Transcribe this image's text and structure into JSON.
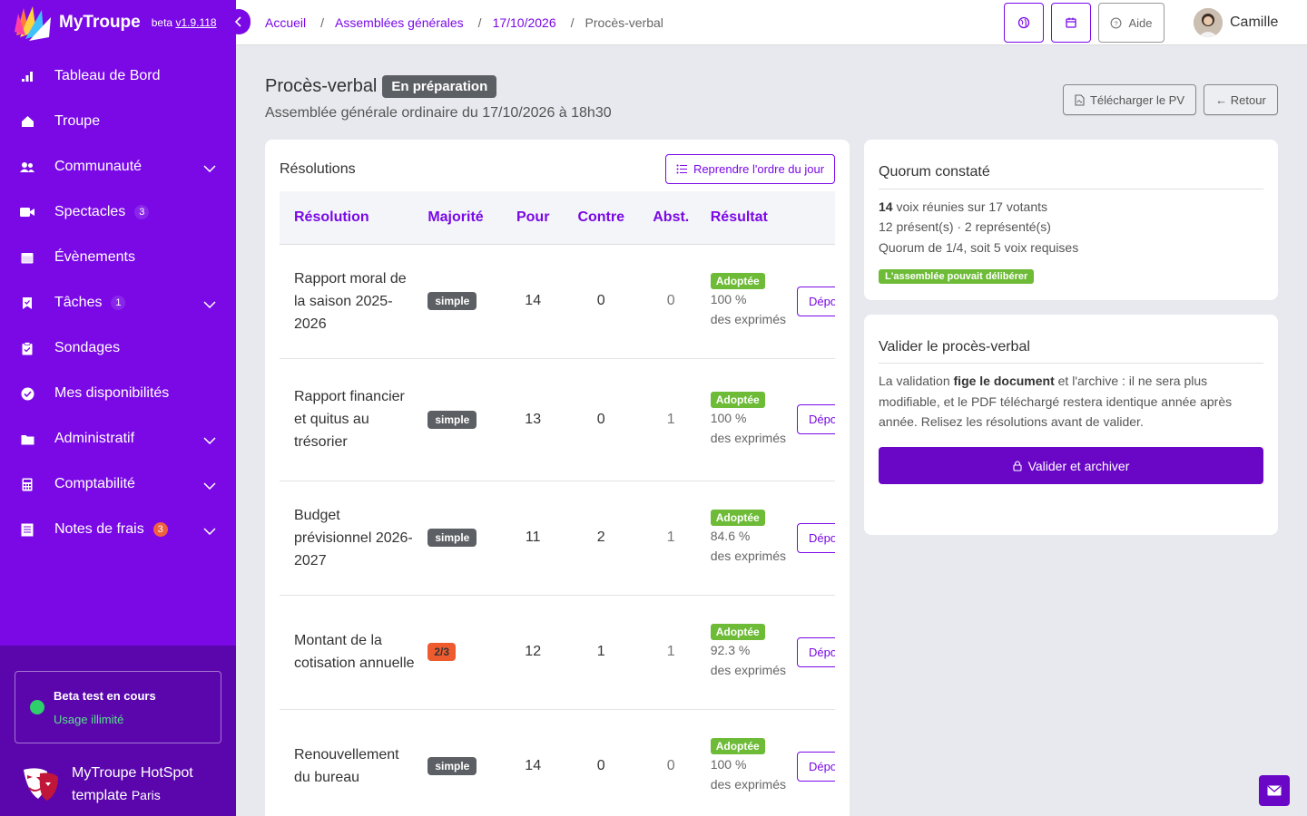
{
  "brand": {
    "name": "MyTroupe",
    "beta_label": "beta",
    "version": "v1.9.118",
    "accent_color": "#7a09e6"
  },
  "sidebar": {
    "items": [
      {
        "label": "Tableau de Bord",
        "icon": "bar-chart-icon",
        "badge": "",
        "chevron": false
      },
      {
        "label": "Troupe",
        "icon": "home-icon",
        "badge": "",
        "chevron": false
      },
      {
        "label": "Communauté",
        "icon": "users-icon",
        "badge": "",
        "chevron": true
      },
      {
        "label": "Spectacles",
        "icon": "video-icon",
        "badge": "3",
        "chevron": false
      },
      {
        "label": "Évènements",
        "icon": "calendar-icon",
        "badge": "",
        "chevron": false
      },
      {
        "label": "Tâches",
        "icon": "bookmark-icon",
        "badge": "1",
        "chevron": true
      },
      {
        "label": "Sondages",
        "icon": "clipboard-icon",
        "badge": "",
        "chevron": false
      },
      {
        "label": "Mes disponibilités",
        "icon": "check-circle-icon",
        "badge": "",
        "chevron": false
      },
      {
        "label": "Administratif",
        "icon": "folder-icon",
        "badge": "",
        "chevron": true
      },
      {
        "label": "Comptabilité",
        "icon": "calculator-icon",
        "badge": "",
        "chevron": true
      },
      {
        "label": "Notes de frais",
        "icon": "receipt-icon",
        "badge": "3",
        "chevron": true
      }
    ],
    "beta": {
      "title": "Beta test en cours",
      "subtitle": "Usage illimité"
    },
    "troupe": {
      "name_line1": "MyTroupe HotSpot",
      "name_line2": "template",
      "city": "Paris"
    }
  },
  "header": {
    "breadcrumb": [
      "Accueil",
      "Assemblées générales",
      "17/10/2026",
      "Procès-verbal"
    ],
    "help_label": "Aide",
    "user_name": "Camille"
  },
  "page": {
    "title": "Procès-verbal",
    "status": "En préparation",
    "subtitle": "Assemblée générale ordinaire du 17/10/2026 à 18h30",
    "download_label": "Télécharger le PV",
    "back_label": "← Retour"
  },
  "resolutions": {
    "title": "Résolutions",
    "agenda_button": "Reprendre l'ordre du jour",
    "columns": [
      "Résolution",
      "Majorité",
      "Pour",
      "Contre",
      "Abst.",
      "Résultat"
    ],
    "rows": [
      {
        "name": "Rapport moral de la saison 2025-2026",
        "majority": "simple",
        "pour": "14",
        "contre": "0",
        "abst": "0",
        "result": "Adoptée",
        "pct": "100 %",
        "pct_label": "des exprimés",
        "action": "Dépouiller"
      },
      {
        "name": "Rapport financier et quitus au trésorier",
        "majority": "simple",
        "pour": "13",
        "contre": "0",
        "abst": "1",
        "result": "Adoptée",
        "pct": "100 %",
        "pct_label": "des exprimés",
        "action": "Dépouiller"
      },
      {
        "name": "Budget prévisionnel 2026-2027",
        "majority": "simple",
        "pour": "11",
        "contre": "2",
        "abst": "1",
        "result": "Adoptée",
        "pct": "84.6 %",
        "pct_label": "des exprimés",
        "action": "Dépouiller"
      },
      {
        "name": "Montant de la cotisation annuelle",
        "majority": "2/3",
        "pour": "12",
        "contre": "1",
        "abst": "1",
        "result": "Adoptée",
        "pct": "92.3 %",
        "pct_label": "des exprimés",
        "action": "Dépouiller"
      },
      {
        "name": "Renouvellement du bureau",
        "majority": "simple",
        "pour": "14",
        "contre": "0",
        "abst": "0",
        "result": "Adoptée",
        "pct": "100 %",
        "pct_label": "des exprimés",
        "action": "Dépouiller"
      }
    ]
  },
  "quorum": {
    "title": "Quorum constaté",
    "present_count": "14",
    "present_text": "voix réunies sur 17 votants",
    "detail": "12 présent(s) · 2 représenté(s)",
    "rule": "Quorum de 1/4, soit 5 voix requises",
    "badge": "L'assemblée pouvait délibérer"
  },
  "validation": {
    "title": "Valider le procès-verbal",
    "text_before": "La validation ",
    "text_bold": "fige le document",
    "text_after": " et l'archive : il ne sera plus modifiable, et le PDF téléchargé restera identique année après année. Relisez les résolutions avant de valider.",
    "button": "Valider et archiver"
  }
}
